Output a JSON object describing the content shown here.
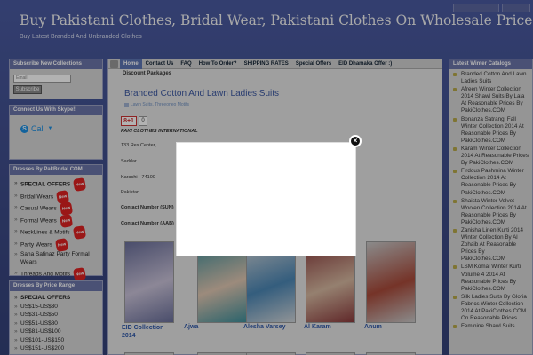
{
  "header": {
    "title": "Buy Pakistani Clothes, Bridal Wear, Pakistani Clothes On Wholesale Price",
    "tagline": "Buy Latest Branded And Unbranded Clothes"
  },
  "search": {
    "placeholder": "Search",
    "icon": "search-icon"
  },
  "subscribe_widget": {
    "title": "Subscribe New Collections",
    "email_placeholder": "Email",
    "button_label": "Subscribe"
  },
  "skype_widget": {
    "title": "Connect Us With Skype!!",
    "call_label": "Call"
  },
  "dresses_widget": {
    "title": "Dresses By PakBridal.COM",
    "items": [
      "SPECIAL OFFERS",
      "Bridal Wears",
      "Casual Wears",
      "Formal Wears",
      "NeckLines & Motifs",
      "Party Wears",
      "Sana Safinaz Party Formal Wears",
      "Threads And Motifs"
    ],
    "badge_label": "New"
  },
  "price_widget": {
    "title": "Dresses By Price Range",
    "items": [
      "SPECIAL OFFERS",
      "US$15-US$30",
      "US$31-US$50",
      "US$51-US$80",
      "US$81-US$100",
      "US$101-US$150",
      "US$151-US$200"
    ]
  },
  "nav": {
    "items": [
      "Home",
      "Contact Us",
      "FAQ",
      "How To Order?",
      "SHIPPING RATES",
      "Special Offers",
      "EID Dhamaka Offer :)"
    ],
    "sub_item": "Discount Packages"
  },
  "post": {
    "title": "Branded Cotton And Lawn Ladies Suits",
    "meta": "Lawn Suits, Threeoneo Motifs",
    "share_label": "8+1",
    "share_count": "0",
    "company": "PAKI CLOTHES INTERNATIONAL",
    "address_lines": [
      "133 Rex Center,",
      "Saddar",
      "Karachi - 74100",
      "Pakistan"
    ],
    "contact_lines": [
      "Contact Number (SUN)",
      "Contact Number (AAB)"
    ]
  },
  "gallery": [
    {
      "caption": "EID Collection 2014",
      "colors": [
        "#6a6f9a",
        "#c9c2d8"
      ]
    },
    {
      "caption": "Ajwa",
      "colors": [
        "#3f8f9b",
        "#e0c7b2"
      ]
    },
    {
      "caption": "Alesha Varsey",
      "colors": [
        "#cfd4d8",
        "#4b86b4"
      ]
    },
    {
      "caption": "Al Karam",
      "colors": [
        "#8a3a3c",
        "#d6b8a0"
      ]
    },
    {
      "caption": "Anum",
      "colors": [
        "#c7c7c7",
        "#a84a3a"
      ]
    }
  ],
  "latest_widget": {
    "title": "Latest Winter Catalogs",
    "items": [
      "Branded Cotton And Lawn Ladies Suits",
      "Afreen Winter Collection 2014 Shawl Suits By Lala At Reasonable Prices By PakiClothes.COM",
      "Bonanza Satrangi Fall Winter Collection 2014 At Reasonable Prices By PakiClothes.COM",
      "Karam Winter Collection 2014 At Reasonable Prices By PakiClothes.COM",
      "Firdous Pashmina Winter Collection 2014 At Reasonable Prices By PakiClothes.COM",
      "Shaista Winter Velvet Woolen Collection 2014 At Reasonable Prices By PakiClothes.COM",
      "Zanisha Linen Kurti 2014 Winter Collection By Al Zohaib At Reasonable Prices By PakiClothes.COM",
      "LSM Komal Winter Kurti Volume 4 2014 At Reasonable Prices By PakiClothes.COM",
      "Silk Ladies Suits By Gloria Fabrics Winter Collection 2014 At PakiClothes.COM On Reasonable Prices",
      "Feminine Shawl Suits"
    ]
  },
  "modal": {
    "close_icon": "close-icon",
    "close_glyph": "×"
  }
}
